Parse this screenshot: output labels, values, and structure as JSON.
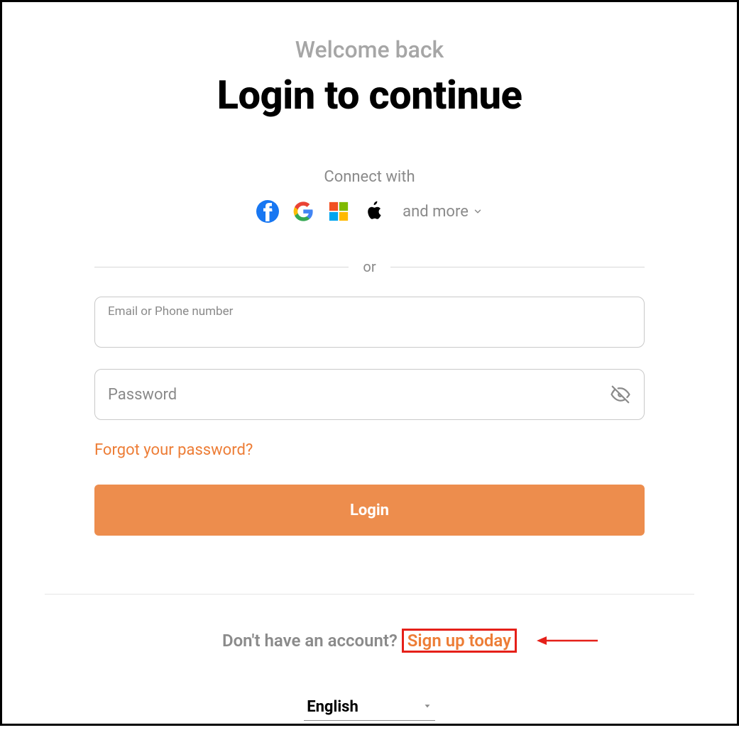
{
  "header": {
    "welcome_back": "Welcome back",
    "title": "Login to continue"
  },
  "social": {
    "connect_label": "Connect with",
    "and_more": "and more"
  },
  "divider": {
    "or": "or"
  },
  "form": {
    "email_label": "Email or Phone number",
    "password_placeholder": "Password",
    "forgot": "Forgot your password?",
    "login_button": "Login"
  },
  "footer": {
    "no_account": "Don't have an account?",
    "signup": "Sign up today",
    "language": "English"
  }
}
